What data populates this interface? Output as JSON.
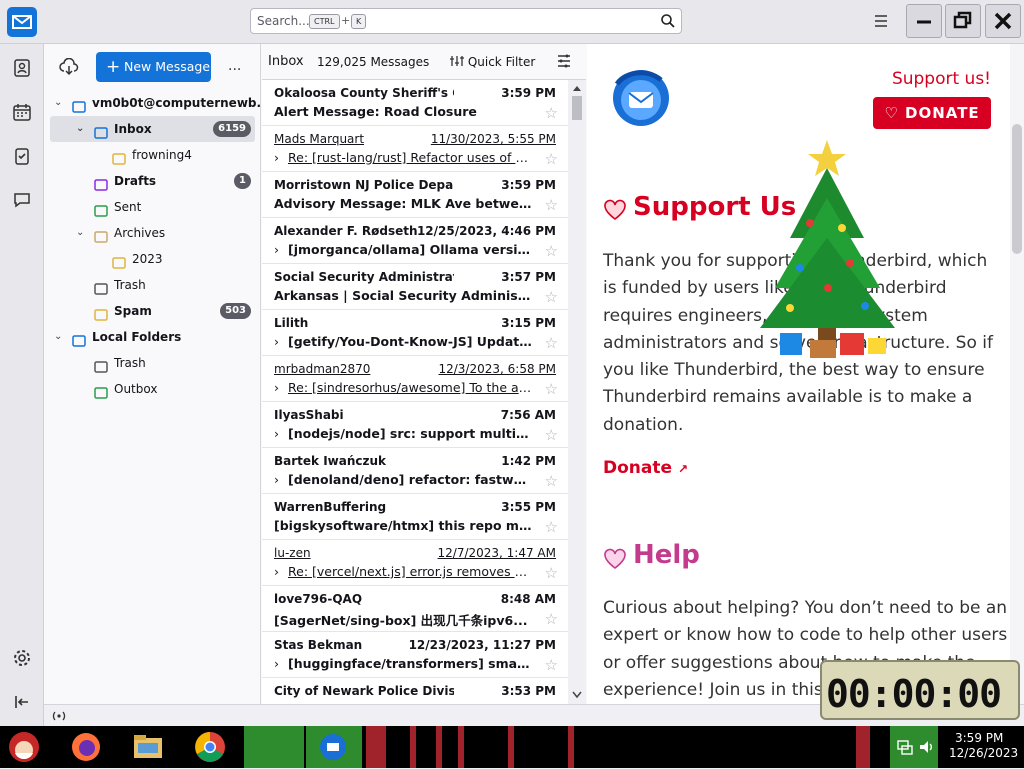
{
  "search": {
    "placeholder": "Search...",
    "key1": "CTRL",
    "plus": "+",
    "key2": "K"
  },
  "spaces": [
    {
      "name": "mail-space-icon"
    },
    {
      "name": "address-book-icon"
    },
    {
      "name": "calendar-icon"
    },
    {
      "name": "tasks-icon"
    },
    {
      "name": "chat-icon"
    }
  ],
  "folder_pane": {
    "new_message": "New Message",
    "more": "...",
    "folders": [
      {
        "label": "vm0b0t@computernewb...",
        "level": 0,
        "bold": true,
        "icon": "account-icon",
        "twisty": "v"
      },
      {
        "label": "Inbox",
        "level": 1,
        "selected": true,
        "icon": "inbox-icon",
        "twisty": "v",
        "count": "6159"
      },
      {
        "label": "frowning4",
        "level": 2,
        "icon": "folder-icon"
      },
      {
        "label": "Drafts",
        "level": 1,
        "bold": true,
        "icon": "drafts-icon",
        "count": "1"
      },
      {
        "label": "Sent",
        "level": 1,
        "icon": "sent-icon"
      },
      {
        "label": "Archives",
        "level": 1,
        "icon": "archives-icon",
        "twisty": "v"
      },
      {
        "label": "2023",
        "level": 2,
        "icon": "folder-icon"
      },
      {
        "label": "Trash",
        "level": 1,
        "icon": "trash-icon"
      },
      {
        "label": "Spam",
        "level": 1,
        "bold": true,
        "icon": "spam-folder-icon",
        "count": "503"
      },
      {
        "label": "Local Folders",
        "level": 0,
        "bold": true,
        "icon": "local-folders-icon",
        "twisty": "v"
      },
      {
        "label": "Trash",
        "level": 1,
        "icon": "trash-icon"
      },
      {
        "label": "Outbox",
        "level": 1,
        "icon": "outbox-icon"
      }
    ]
  },
  "message_list": {
    "folder": "Inbox",
    "count": "129,025 Messages",
    "quick_filter": "Quick Filter",
    "messages": [
      {
        "from": "Okaloosa County Sheriff's Office",
        "date": "3:59 PM",
        "subject": "Alert Message: Road Closure",
        "unread": true,
        "thread": false
      },
      {
        "from": "Mads Marquart",
        "date": "11/30/2023, 5:55 PM",
        "subject": "Re: [rust-lang/rust] Refactor uses of `obj...",
        "unread": false,
        "thread": true,
        "linky": true
      },
      {
        "from": "Morristown NJ Police Department",
        "date": "3:59 PM",
        "subject": "Advisory Message: MLK Ave between S...",
        "unread": true,
        "thread": false
      },
      {
        "from": "Alexander F. Rødseth",
        "date": "12/25/2023, 4:46 PM",
        "subject": "[jmorganca/ollama] Ollama version (...",
        "unread": true,
        "thread": true
      },
      {
        "from": "Social Security Administration",
        "date": "3:57 PM",
        "subject": "Arkansas | Social Security Administratio...",
        "unread": true,
        "thread": false
      },
      {
        "from": "Lilith",
        "date": "3:15 PM",
        "subject": "[getify/You-Dont-Know-JS] Update c...",
        "unread": true,
        "thread": true
      },
      {
        "from": "mrbadman2870",
        "date": "12/3/2023, 6:58 PM",
        "subject": "Re: [sindresorhus/awesome] To the awe...",
        "unread": false,
        "thread": true,
        "linky": true
      },
      {
        "from": "IlyasShabi",
        "date": "7:56 AM",
        "subject": "[nodejs/node] src: support multi-line...",
        "unread": true,
        "thread": true
      },
      {
        "from": "Bartek Iwańczuk",
        "date": "1:42 PM",
        "subject": "[denoland/deno] refactor: fastwebso...",
        "unread": true,
        "thread": true
      },
      {
        "from": "WarrenBuffering",
        "date": "3:55 PM",
        "subject": "[bigskysoftware/htmx] this repo makes ...",
        "unread": true,
        "thread": false
      },
      {
        "from": "lu-zen",
        "date": "12/7/2023, 1:47 AM",
        "subject": "Re: [vercel/next.js] error.js removes any ...",
        "unread": false,
        "thread": true,
        "linky": true
      },
      {
        "from": "love796-QAQ",
        "date": "8:48 AM",
        "subject": "[SagerNet/sing-box] 出现几千条ipv6...",
        "unread": true,
        "thread": false
      },
      {
        "from": "Stas Bekman",
        "date": "12/23/2023, 11:27 PM",
        "subject": "[huggingface/transformers] small ty...",
        "unread": true,
        "thread": true
      },
      {
        "from": "City of Newark Police Division",
        "date": "3:53 PM",
        "subject": "",
        "unread": true,
        "thread": false
      }
    ]
  },
  "content": {
    "support_us_link": "Support us!",
    "donate_button": "DONATE",
    "support_heading": "Support Us",
    "support_body": "Thank you for supporting Thunderbird, which is funded by users like you! Thunderbird requires engineers, designers, system administrators and server infrastructure. So if you like Thunderbird, the best way to ensure Thunderbird remains available is to make a donation.",
    "donate_link": "Donate",
    "help_heading": "Help",
    "help_body": "Curious about helping? You don’t need to be an expert or know how to code to help other users or offer suggestions about how to make the experience! Join us in this community"
  },
  "clock": {
    "display": "00:00:00"
  },
  "taskbar": {
    "time": "3:59 PM",
    "date": "12/26/2023"
  },
  "colors": {
    "accent": "#1373d9",
    "donate_red": "#d70022",
    "help_pink": "#c43a8d"
  }
}
